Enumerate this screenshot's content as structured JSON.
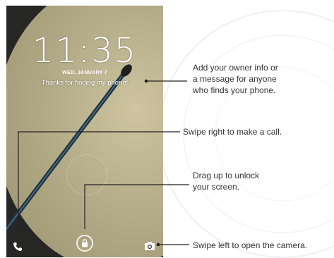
{
  "lockscreen": {
    "time": "11:35",
    "date": "WED, JANUARY 7",
    "owner_message": "Thanks for finding my phone!"
  },
  "callouts": {
    "owner_info": "Add your owner info or\na message for anyone\nwho finds your phone.",
    "swipe_call": "Swipe right to make a call.",
    "drag_unlock": "Drag up to unlock\nyour screen.",
    "swipe_camera": "Swipe left to open the camera."
  },
  "icons": {
    "phone": "phone-icon",
    "lock": "lock-icon",
    "camera": "camera-icon"
  },
  "colors": {
    "callout_text": "#333333",
    "callout_line": "#222222",
    "wallpaper_disc": "#c9bf9a",
    "wallpaper_dark": "#262624"
  }
}
